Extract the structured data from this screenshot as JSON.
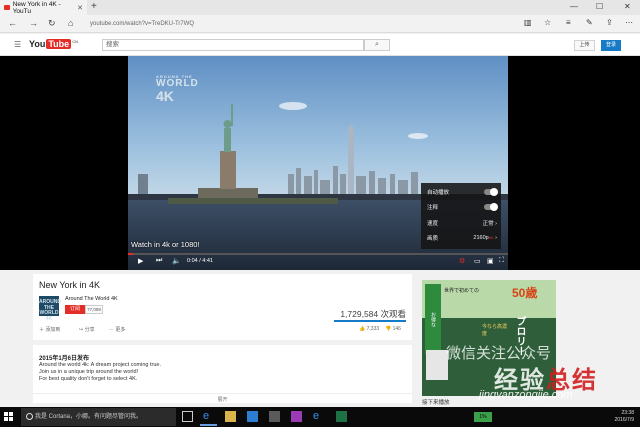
{
  "browser": {
    "tab_title": "New York in 4K - YouTu",
    "new_tab": "+",
    "url": "youtube.com/watch?v=TreDKU-Tr7WQ",
    "window_buttons": [
      "—",
      "☐",
      "✕"
    ]
  },
  "youtube_header": {
    "logo_you": "You",
    "logo_tube": "Tube",
    "logo_region": "CN",
    "search_placeholder": "搜索",
    "upload_label": "上传",
    "signin_label": "登录"
  },
  "player": {
    "overlay_brand_small": "AROUND THE",
    "overlay_brand_mid": "WORLD",
    "overlay_brand_k": "4K",
    "caption": "Watch in 4k or 1080!",
    "current_time": "0:04 / 4:41",
    "played_fraction": 0.014,
    "settings": {
      "autoplay_label": "自动播放",
      "annotations_label": "注释",
      "speed_label": "速度",
      "speed_value": "正常",
      "quality_label": "画质",
      "quality_value": "2160p",
      "quality_badge": "4K"
    }
  },
  "video_info": {
    "title": "New York in 4K",
    "channel_avatar_text": "AROUND THE WORLD 4K",
    "channel_name": "Around The World 4K",
    "subscribe_label": "订阅",
    "subscriber_count": "77,059",
    "views": "1,729,584 次观看",
    "actions": {
      "add_label": "添加到",
      "share_label": "分享",
      "more_label": "更多"
    },
    "likes": "7,333",
    "dislikes": "146"
  },
  "description": {
    "publish_date": "2015年1月6日发布",
    "lines": [
      "Around the world 4k: A dream project coming true.",
      "Join us in a unique trip around the world!",
      "For best quality don't forget to select 4K."
    ],
    "show_more": "展开"
  },
  "sidebar": {
    "ad_texts": [
      "世界で初めての",
      "今なら高濃度",
      "50歳",
      "プロリー",
      "お得な"
    ],
    "next_label": "接下来播放"
  },
  "watermark": {
    "line1": "微信关注公众号",
    "line2_a": "经验",
    "line2_b": "总结",
    "line3": "jingyanzongjie.com"
  },
  "taskbar": {
    "cortana_placeholder": "我是 Cortana，小娜。有问题尽管问我。",
    "battery": "1%",
    "time": "23:38",
    "date": "2016/7/9"
  }
}
